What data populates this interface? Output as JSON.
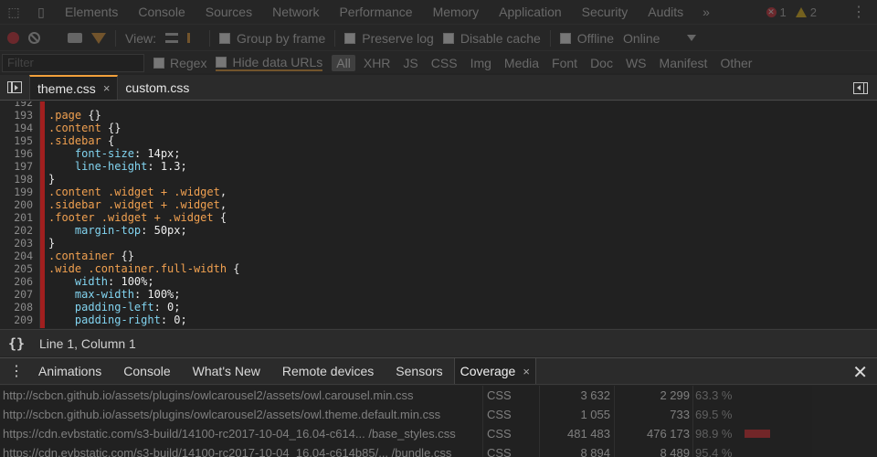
{
  "devtools": {
    "main_tabs": [
      "Elements",
      "Console",
      "Sources",
      "Network",
      "Performance",
      "Memory",
      "Application",
      "Security",
      "Audits"
    ],
    "more_tabs": "»",
    "error_count": "1",
    "warning_count": "2"
  },
  "network_toolbar": {
    "view_label": "View:",
    "group_by_frame": "Group by frame",
    "preserve_log": "Preserve log",
    "disable_cache": "Disable cache",
    "offline": "Offline",
    "throttle": "Online"
  },
  "filter_bar": {
    "placeholder": "Filter",
    "regex": "Regex",
    "hide_data_urls": "Hide data URLs",
    "types": [
      "All",
      "XHR",
      "JS",
      "CSS",
      "Img",
      "Media",
      "Font",
      "Doc",
      "WS",
      "Manifest",
      "Other"
    ]
  },
  "editor": {
    "tabs": [
      {
        "label": "theme.css",
        "close": "×"
      },
      {
        "label": "custom.css"
      }
    ],
    "code_lines": [
      {
        "n": "192",
        "parts": []
      },
      {
        "n": "193",
        "parts": [
          {
            "t": ".page",
            "c": "sel"
          },
          {
            "t": " {}",
            "c": "punc"
          }
        ]
      },
      {
        "n": "194",
        "parts": [
          {
            "t": ".content",
            "c": "sel"
          },
          {
            "t": " {}",
            "c": "punc"
          }
        ]
      },
      {
        "n": "195",
        "parts": [
          {
            "t": ".sidebar",
            "c": "sel"
          },
          {
            "t": " {",
            "c": "punc"
          }
        ]
      },
      {
        "n": "196",
        "parts": [
          {
            "t": "    ",
            "c": "punc"
          },
          {
            "t": "font-size",
            "c": "prop"
          },
          {
            "t": ": 14px;",
            "c": "val"
          }
        ]
      },
      {
        "n": "197",
        "parts": [
          {
            "t": "    ",
            "c": "punc"
          },
          {
            "t": "line-height",
            "c": "prop"
          },
          {
            "t": ": 1.3;",
            "c": "val"
          }
        ]
      },
      {
        "n": "198",
        "parts": [
          {
            "t": "}",
            "c": "punc"
          }
        ]
      },
      {
        "n": "199",
        "parts": [
          {
            "t": ".content .widget + .widget",
            "c": "sel"
          },
          {
            "t": ",",
            "c": "punc"
          }
        ]
      },
      {
        "n": "200",
        "parts": [
          {
            "t": ".sidebar .widget + .widget",
            "c": "sel"
          },
          {
            "t": ",",
            "c": "punc"
          }
        ]
      },
      {
        "n": "201",
        "parts": [
          {
            "t": ".footer .widget + .widget",
            "c": "sel"
          },
          {
            "t": " {",
            "c": "punc"
          }
        ]
      },
      {
        "n": "202",
        "parts": [
          {
            "t": "    ",
            "c": "punc"
          },
          {
            "t": "margin-top",
            "c": "prop"
          },
          {
            "t": ": 50px;",
            "c": "val"
          }
        ]
      },
      {
        "n": "203",
        "parts": [
          {
            "t": "}",
            "c": "punc"
          }
        ]
      },
      {
        "n": "204",
        "parts": [
          {
            "t": ".container",
            "c": "sel"
          },
          {
            "t": " {}",
            "c": "punc"
          }
        ]
      },
      {
        "n": "205",
        "parts": [
          {
            "t": ".wide .container.full-width",
            "c": "sel"
          },
          {
            "t": " {",
            "c": "punc"
          }
        ]
      },
      {
        "n": "206",
        "parts": [
          {
            "t": "    ",
            "c": "punc"
          },
          {
            "t": "width",
            "c": "prop"
          },
          {
            "t": ": 100%;",
            "c": "val"
          }
        ]
      },
      {
        "n": "207",
        "parts": [
          {
            "t": "    ",
            "c": "punc"
          },
          {
            "t": "max-width",
            "c": "prop"
          },
          {
            "t": ": 100%;",
            "c": "val"
          }
        ]
      },
      {
        "n": "208",
        "parts": [
          {
            "t": "    ",
            "c": "punc"
          },
          {
            "t": "padding-left",
            "c": "prop"
          },
          {
            "t": ": 0;",
            "c": "val"
          }
        ]
      },
      {
        "n": "209",
        "parts": [
          {
            "t": "    ",
            "c": "punc"
          },
          {
            "t": "padding-right",
            "c": "prop"
          },
          {
            "t": ": 0;",
            "c": "val"
          }
        ]
      }
    ],
    "status": "Line 1, Column 1",
    "pretty_print_glyph": "{}"
  },
  "drawer": {
    "tabs": [
      "Animations",
      "Console",
      "What's New",
      "Remote devices",
      "Sensors"
    ],
    "active_tab": "Coverage",
    "active_close": "×",
    "close": "✕"
  },
  "coverage": {
    "rows": [
      {
        "url": "http://scbcn.github.io/assets/plugins/owlcarousel2/assets/owl.carousel.min.css",
        "type": "CSS",
        "total": "3 632",
        "unused": "2 299",
        "pct": "63.3 %",
        "bar": 0
      },
      {
        "url": "http://scbcn.github.io/assets/plugins/owlcarousel2/assets/owl.theme.default.min.css",
        "type": "CSS",
        "total": "1 055",
        "unused": "733",
        "pct": "69.5 %",
        "bar": 0
      },
      {
        "url": "https://cdn.evbstatic.com/s3-build/14100-rc2017-10-04_16.04-c614... /base_styles.css",
        "type": "CSS",
        "total": "481 483",
        "unused": "476 173",
        "pct": "98.9 %",
        "bar": 1
      },
      {
        "url": "https://cdn.evbstatic.com/s3-build/14100-rc2017-10-04_16.04-c614b85/... /bundle.css",
        "type": "CSS",
        "total": "8 894",
        "unused": "8 489",
        "pct": "95.4 %",
        "bar": 0
      }
    ]
  },
  "colors": {
    "selector": "#f0a050",
    "property": "#82d4f0",
    "coverage_unused": "#a11f1f",
    "active_tab_accent": "#f2a03b"
  }
}
